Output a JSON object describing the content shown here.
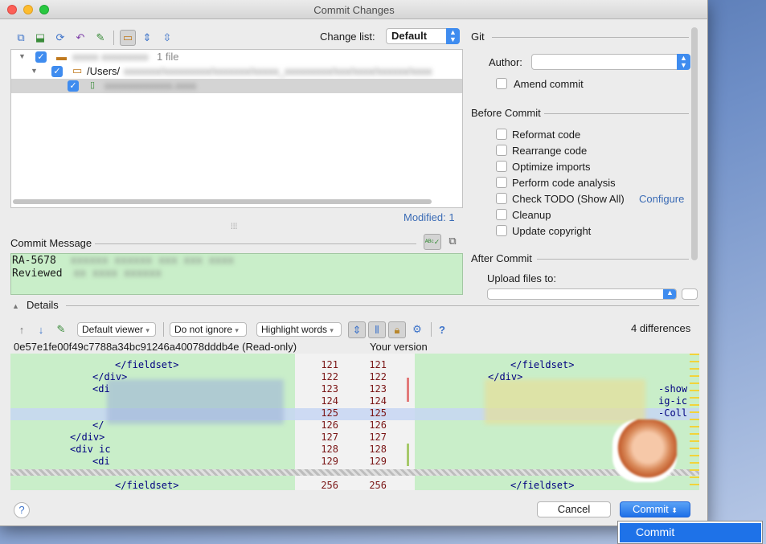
{
  "window": {
    "title": "Commit Changes"
  },
  "toolbar": {
    "icons": [
      "show-diff-icon",
      "move-to-changelist-icon",
      "refresh-icon",
      "rollback-icon",
      "edit-source-icon",
      "group-by-directory-icon",
      "expand-all-icon",
      "collapse-all-icon"
    ]
  },
  "changelist": {
    "label": "Change list:",
    "value": "Default"
  },
  "tree": {
    "root_count": "1 file",
    "path_prefix": "/Users/",
    "modified": "Modified: 1"
  },
  "commit_message": {
    "label": "Commit Message",
    "lines": [
      "RA-5678",
      "Reviewed"
    ]
  },
  "git": {
    "section": "Git",
    "author_label": "Author:",
    "author_value": "",
    "amend": "Amend commit"
  },
  "before_commit": {
    "section": "Before Commit",
    "options": [
      "Reformat code",
      "Rearrange code",
      "Optimize imports",
      "Perform code analysis",
      "Check TODO (Show All)",
      "Cleanup",
      "Update copyright"
    ],
    "configure": "Configure"
  },
  "after_commit": {
    "section": "After Commit",
    "upload_label": "Upload files to:"
  },
  "details": {
    "label": "Details",
    "viewer": "Default viewer",
    "ignore": "Do not ignore",
    "highlight": "Highlight words",
    "help": "?",
    "count": "4 differences",
    "left_title": "0e57e1fe00f49c7788a34bc91246a40078dddb4e (Read-only)",
    "right_title": "Your version"
  },
  "diff": {
    "line_numbers": [
      "121",
      "122",
      "123",
      "124",
      "125",
      "126",
      "127",
      "128",
      "129",
      "256"
    ],
    "left_lines": [
      "</fieldset>",
      "</div>",
      "<di",
      "",
      "",
      "</",
      "</div>",
      "<div ic",
      "<di",
      "</fieldset>"
    ],
    "right_lines": [
      "</fieldset>",
      "</div>",
      "",
      "-show",
      "ig-ic",
      "-Coll",
      "",
      "",
      "",
      "</fieldset>"
    ]
  },
  "buttons": {
    "help": "?",
    "cancel": "Cancel",
    "commit": "Commit"
  },
  "commit_menu": {
    "item": "Commit"
  },
  "colors": {
    "accent": "#3f8cef",
    "diff_bg": "#c9eec9",
    "link": "#3a6bb5"
  }
}
